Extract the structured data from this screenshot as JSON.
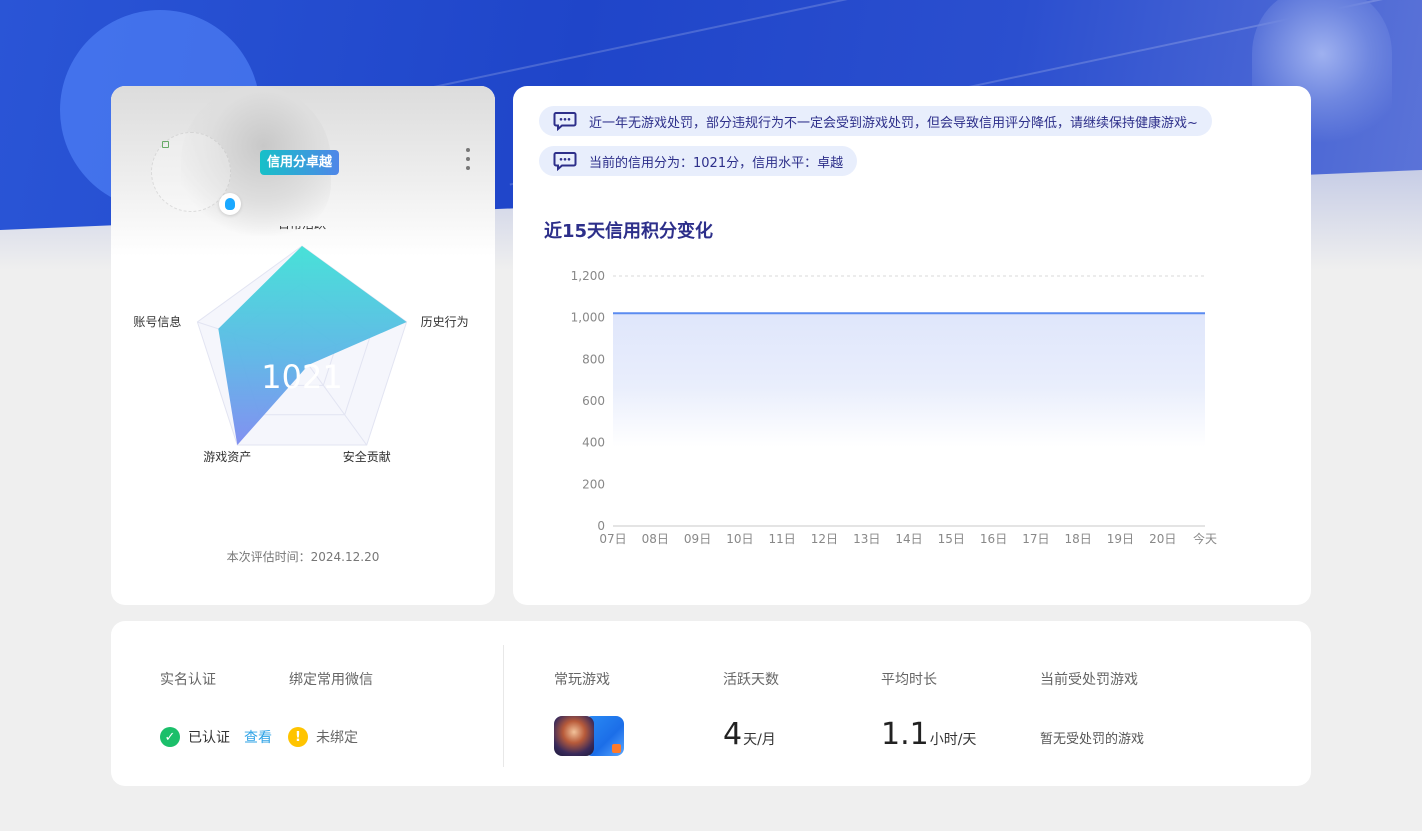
{
  "profile": {
    "credit_tag": "信用分卓越",
    "score": "1021",
    "eval_time": "本次评估时间：2024.12.20",
    "radar": {
      "axes": [
        "日常活跃",
        "历史行为",
        "安全贡献",
        "游戏资产",
        "账号信息"
      ],
      "values": [
        1.0,
        1.0,
        0.1,
        1.0,
        0.8
      ]
    }
  },
  "notices": {
    "line1": "近一年无游戏处罚，部分违规行为不一定会受到游戏处罚，但会导致信用评分降低，请继续保持健康游戏~",
    "line2": "当前的信用分为：1021分，信用水平：卓越"
  },
  "chart": {
    "title": "近15天信用积分变化"
  },
  "chart_data": {
    "type": "area",
    "title": "近15天信用积分变化",
    "xlabel": "",
    "ylabel": "",
    "categories": [
      "07日",
      "08日",
      "09日",
      "10日",
      "11日",
      "12日",
      "13日",
      "14日",
      "15日",
      "16日",
      "17日",
      "18日",
      "19日",
      "20日",
      "今天"
    ],
    "y_ticks": [
      "0",
      "200",
      "400",
      "600",
      "800",
      "1,000",
      "1,200"
    ],
    "ylim": [
      0,
      1200
    ],
    "series": [
      {
        "values": [
          1021,
          1021,
          1021,
          1021,
          1021,
          1021,
          1021,
          1021,
          1021,
          1021,
          1021,
          1021,
          1021,
          1021,
          1021
        ]
      }
    ],
    "grid": "dashed top line"
  },
  "bottom": {
    "real_name_label": "实名认证",
    "wechat_label": "绑定常用微信",
    "real_name_status": "已认证",
    "view_link": "查看",
    "wechat_status": "未绑定",
    "games_label": "常玩游戏",
    "active_days_label": "活跃天数",
    "active_days_value": "4",
    "active_days_unit": "天/月",
    "avg_time_label": "平均时长",
    "avg_time_value": "1.1",
    "avg_time_unit": "小时/天",
    "penalty_label": "当前受处罚游戏",
    "penalty_value": "暂无受处罚的游戏"
  },
  "colors": {
    "brand_blue": "#2a55d6",
    "accent_text": "#2d2f8a",
    "chart_line": "#5b8bf0",
    "success": "#1bbf6a",
    "warning": "#ffc400",
    "link": "#2fa3e6"
  }
}
